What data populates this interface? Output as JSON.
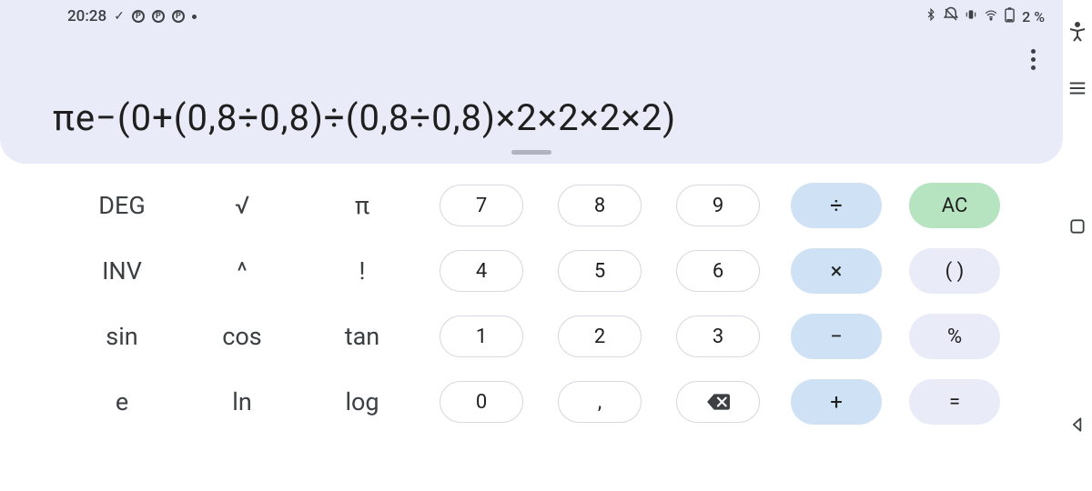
{
  "statusbar": {
    "time": "20:28",
    "battery_pct": "2 %"
  },
  "menu": {},
  "expression": "πe−(0+(0,8÷0,8)÷(0,8÷0,8)×2×2×2×2)",
  "functions": {
    "r0": [
      "DEG",
      "√",
      "π"
    ],
    "r1": [
      "INV",
      "^",
      "!"
    ],
    "r2": [
      "sin",
      "cos",
      "tan"
    ],
    "r3": [
      "e",
      "ln",
      "log"
    ]
  },
  "numpad": {
    "r0": [
      "7",
      "8",
      "9"
    ],
    "r1": [
      "4",
      "5",
      "6"
    ],
    "r2": [
      "1",
      "2",
      "3"
    ],
    "r3": [
      "0",
      ",",
      ""
    ]
  },
  "ops": {
    "r0": "÷",
    "r1": "×",
    "r2": "−",
    "r3": "+"
  },
  "right": {
    "r0": "AC",
    "r1": "( )",
    "r2": "%",
    "r3": "="
  }
}
